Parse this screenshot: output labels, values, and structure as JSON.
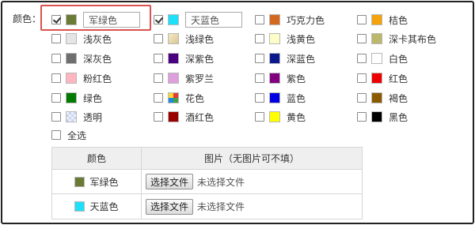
{
  "form": {
    "colors_label": "颜色：",
    "colors": [
      {
        "label": "军绿色",
        "swatch": "#6b7b35",
        "checked": true,
        "editable": true,
        "pattern": ""
      },
      {
        "label": "天蓝色",
        "swatch": "#1ee0f8",
        "checked": true,
        "editable": true,
        "pattern": ""
      },
      {
        "label": "巧克力色",
        "swatch": "#d2691e",
        "checked": false,
        "editable": false,
        "pattern": ""
      },
      {
        "label": "桔色",
        "swatch": "#f5a30a",
        "checked": false,
        "editable": false,
        "pattern": ""
      },
      {
        "label": "浅灰色",
        "swatch": "#e5e5e5",
        "checked": false,
        "editable": false,
        "pattern": ""
      },
      {
        "label": "浅绿色",
        "swatch": "#e8d8a8",
        "checked": false,
        "editable": false,
        "pattern": "lightgreen"
      },
      {
        "label": "浅黄色",
        "swatch": "#fdfdc8",
        "checked": false,
        "editable": false,
        "pattern": ""
      },
      {
        "label": "深卡其布色",
        "swatch": "#bdb76b",
        "checked": false,
        "editable": false,
        "pattern": ""
      },
      {
        "label": "深灰色",
        "swatch": "#6e6e6e",
        "checked": false,
        "editable": false,
        "pattern": ""
      },
      {
        "label": "深紫色",
        "swatch": "#4b0082",
        "checked": false,
        "editable": false,
        "pattern": ""
      },
      {
        "label": "深蓝色",
        "swatch": "#0a1a8c",
        "checked": false,
        "editable": false,
        "pattern": ""
      },
      {
        "label": "白色",
        "swatch": "#ffffff",
        "checked": false,
        "editable": false,
        "pattern": ""
      },
      {
        "label": "粉红色",
        "swatch": "#ffb6c1",
        "checked": false,
        "editable": false,
        "pattern": ""
      },
      {
        "label": "紫罗兰",
        "swatch": "#dda0dd",
        "checked": false,
        "editable": false,
        "pattern": ""
      },
      {
        "label": "紫色",
        "swatch": "#800080",
        "checked": false,
        "editable": false,
        "pattern": ""
      },
      {
        "label": "红色",
        "swatch": "#ee0000",
        "checked": false,
        "editable": false,
        "pattern": ""
      },
      {
        "label": "绿色",
        "swatch": "#007a00",
        "checked": false,
        "editable": false,
        "pattern": ""
      },
      {
        "label": "花色",
        "swatch": "#e53935",
        "checked": false,
        "editable": false,
        "pattern": "floral"
      },
      {
        "label": "蓝色",
        "swatch": "#0000e0",
        "checked": false,
        "editable": false,
        "pattern": ""
      },
      {
        "label": "褐色",
        "swatch": "#8b5a00",
        "checked": false,
        "editable": false,
        "pattern": ""
      },
      {
        "label": "透明",
        "swatch": "#dde6f5",
        "checked": false,
        "editable": false,
        "pattern": "transparent"
      },
      {
        "label": "酒红色",
        "swatch": "#990000",
        "checked": false,
        "editable": false,
        "pattern": ""
      },
      {
        "label": "黄色",
        "swatch": "#ffff00",
        "checked": false,
        "editable": false,
        "pattern": ""
      },
      {
        "label": "黑色",
        "swatch": "#000000",
        "checked": false,
        "editable": false,
        "pattern": ""
      }
    ],
    "select_all_label": "全选",
    "highlight_color": "#d9534f"
  },
  "table": {
    "header_color": "颜色",
    "header_image": "图片（无图片可不填）",
    "rows": [
      {
        "color": "军绿色",
        "swatch": "#6b7b35",
        "button": "选择文件",
        "status": "未选择文件"
      },
      {
        "color": "天蓝色",
        "swatch": "#1ee0f8",
        "button": "选择文件",
        "status": "未选择文件"
      }
    ]
  }
}
